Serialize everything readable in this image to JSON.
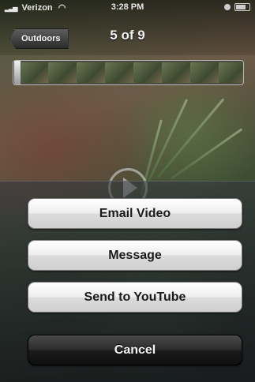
{
  "status_bar": {
    "carrier": "Verizon",
    "time": "3:28 PM"
  },
  "nav": {
    "back_label": "Outdoors",
    "title": "5 of 9"
  },
  "action_sheet": {
    "buttons": [
      {
        "label": "Email Video",
        "style": "default"
      },
      {
        "label": "Message",
        "style": "default"
      },
      {
        "label": "Send to YouTube",
        "style": "default"
      },
      {
        "label": "Cancel",
        "style": "cancel"
      }
    ]
  },
  "icons": {
    "signal": "signal-bars-icon",
    "wifi": "wifi-icon",
    "lock": "rotation-lock-icon",
    "battery": "battery-icon",
    "play": "play-icon"
  },
  "colors": {
    "cancel_button": "#1b1b1b",
    "default_button": "#e6e6e6"
  }
}
